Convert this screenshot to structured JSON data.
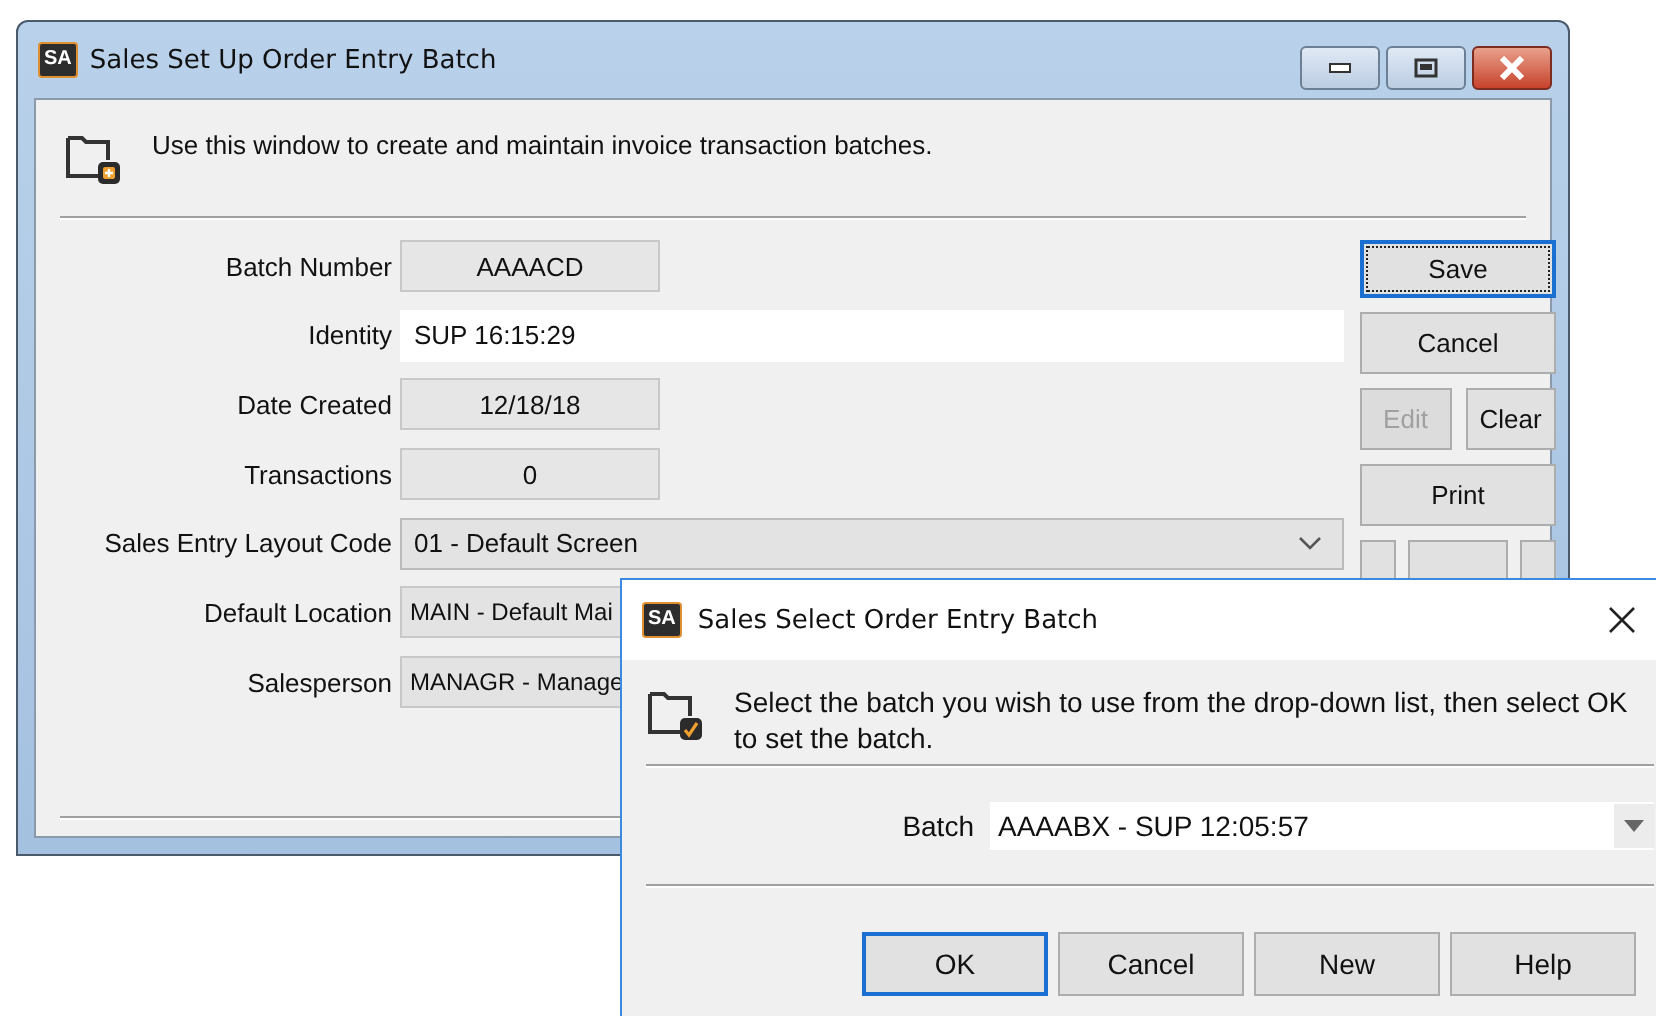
{
  "main_window": {
    "title": "Sales Set Up Order Entry Batch",
    "app_badge": "SA",
    "header_text": "Use this window to create and maintain invoice transaction batches.",
    "fields": [
      {
        "label": "Batch Number",
        "value": "AAAACD",
        "kind": "display"
      },
      {
        "label": "Identity",
        "value": "SUP 16:15:29",
        "kind": "text"
      },
      {
        "label": "Date Created",
        "value": "12/18/18",
        "kind": "display"
      },
      {
        "label": "Transactions",
        "value": "0",
        "kind": "display"
      },
      {
        "label": "Sales Entry Layout Code",
        "value": "01 - Default Screen",
        "kind": "dropdown"
      },
      {
        "label": "Default Location",
        "value": "MAIN - Default Mai",
        "kind": "lookup"
      },
      {
        "label": "Salesperson",
        "value": "MANAGR - Manage",
        "kind": "lookup"
      }
    ],
    "buttons": [
      {
        "label": "Save",
        "kind": "full",
        "disabled": false,
        "focused": true
      },
      {
        "label": "Cancel",
        "kind": "full",
        "disabled": false,
        "focused": false
      },
      {
        "label": "Edit",
        "kind": "half",
        "disabled": true,
        "focused": false
      },
      {
        "label": "Clear",
        "kind": "half",
        "disabled": false,
        "focused": false
      },
      {
        "label": "Print",
        "kind": "full",
        "disabled": false,
        "focused": false
      }
    ]
  },
  "dialog": {
    "title": "Sales Select Order Entry Batch",
    "app_badge": "SA",
    "message": "Select the batch you wish to use from the drop-down list, then select OK to set the batch.",
    "field": {
      "label": "Batch",
      "value": "AAAABX - SUP 12:05:57"
    },
    "buttons": [
      {
        "label": "OK",
        "focused": true
      },
      {
        "label": "Cancel",
        "focused": false
      },
      {
        "label": "New",
        "focused": false
      },
      {
        "label": "Help",
        "focused": false
      }
    ]
  }
}
